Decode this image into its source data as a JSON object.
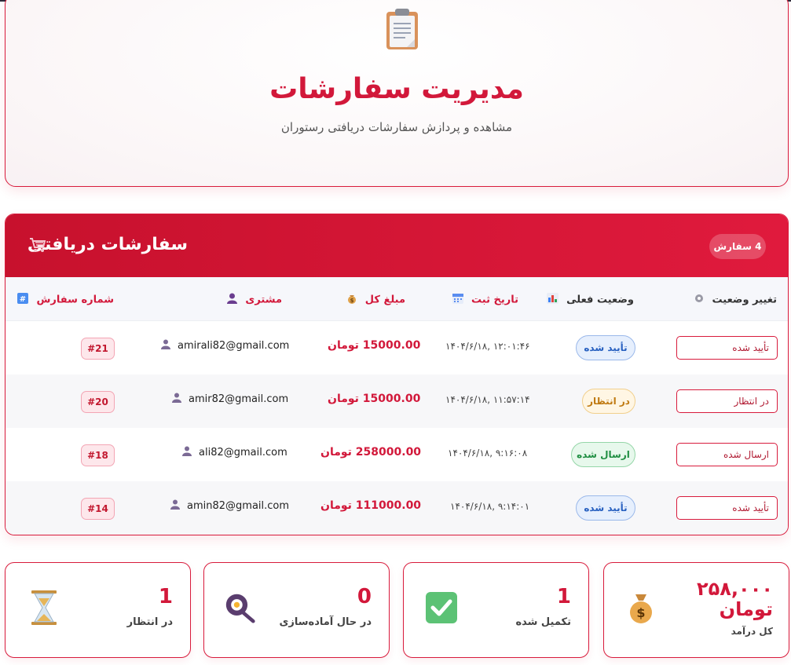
{
  "header": {
    "icon": "clipboard-icon",
    "title": "مدیریت سفارشات",
    "subtitle": "مشاهده و پردازش سفارشات دریافتی رستوران"
  },
  "orders": {
    "title": "سفارشات دریافتی",
    "icon": "shopping-cart-icon",
    "count_badge": "4 سفارش",
    "columns": {
      "change_status": "تغییر وضعیت",
      "current_status": "وضعیت فعلی",
      "date": "تاریخ ثبت",
      "amount": "مبلغ کل",
      "customer": "مشتری",
      "order_number": "شماره سفارش"
    },
    "rows": [
      {
        "select_value": "تأیید شده",
        "status": "تأیید شده",
        "date": "۱۴۰۴/۶/۱۸, ۱۲:۰۱:۴۶",
        "amount": "15000.00 تومان",
        "customer": "amirali82@gmail.com",
        "order_id": "#21"
      },
      {
        "select_value": "در انتظار",
        "status": "در انتظار",
        "date": "۱۴۰۴/۶/۱۸, ۱۱:۵۷:۱۴",
        "amount": "15000.00 تومان",
        "customer": "amir82@gmail.com",
        "order_id": "#20"
      },
      {
        "select_value": "ارسال شده",
        "status": "ارسال شده",
        "date": "۱۴۰۴/۶/۱۸, ۹:۱۶:۰۸",
        "amount": "258000.00 تومان",
        "customer": "ali82@gmail.com",
        "order_id": "#18"
      },
      {
        "select_value": "تأیید شده",
        "status": "تأیید شده",
        "date": "۱۴۰۴/۶/۱۸, ۹:۱۴:۰۱",
        "amount": "111000.00 تومان",
        "customer": "amin82@gmail.com",
        "order_id": "#14"
      }
    ]
  },
  "stats": {
    "revenue": {
      "value_line1": "۲۵۸,۰۰۰",
      "value_line2": "تومان",
      "label": "کل درآمد",
      "icon": "money-bag-icon"
    },
    "completed": {
      "value": "1",
      "label": "تکمیل شده",
      "icon": "check-mark-icon"
    },
    "preparing": {
      "value": "0",
      "label": "در حال آماده‌سازی",
      "icon": "frying-pan-icon"
    },
    "pending": {
      "value": "1",
      "label": "در انتظار",
      "icon": "hourglass-icon"
    }
  },
  "colors": {
    "accent": "#d2183a",
    "confirmed": "#2760c0",
    "pending": "#c07a12",
    "sent": "#1f8e42"
  }
}
